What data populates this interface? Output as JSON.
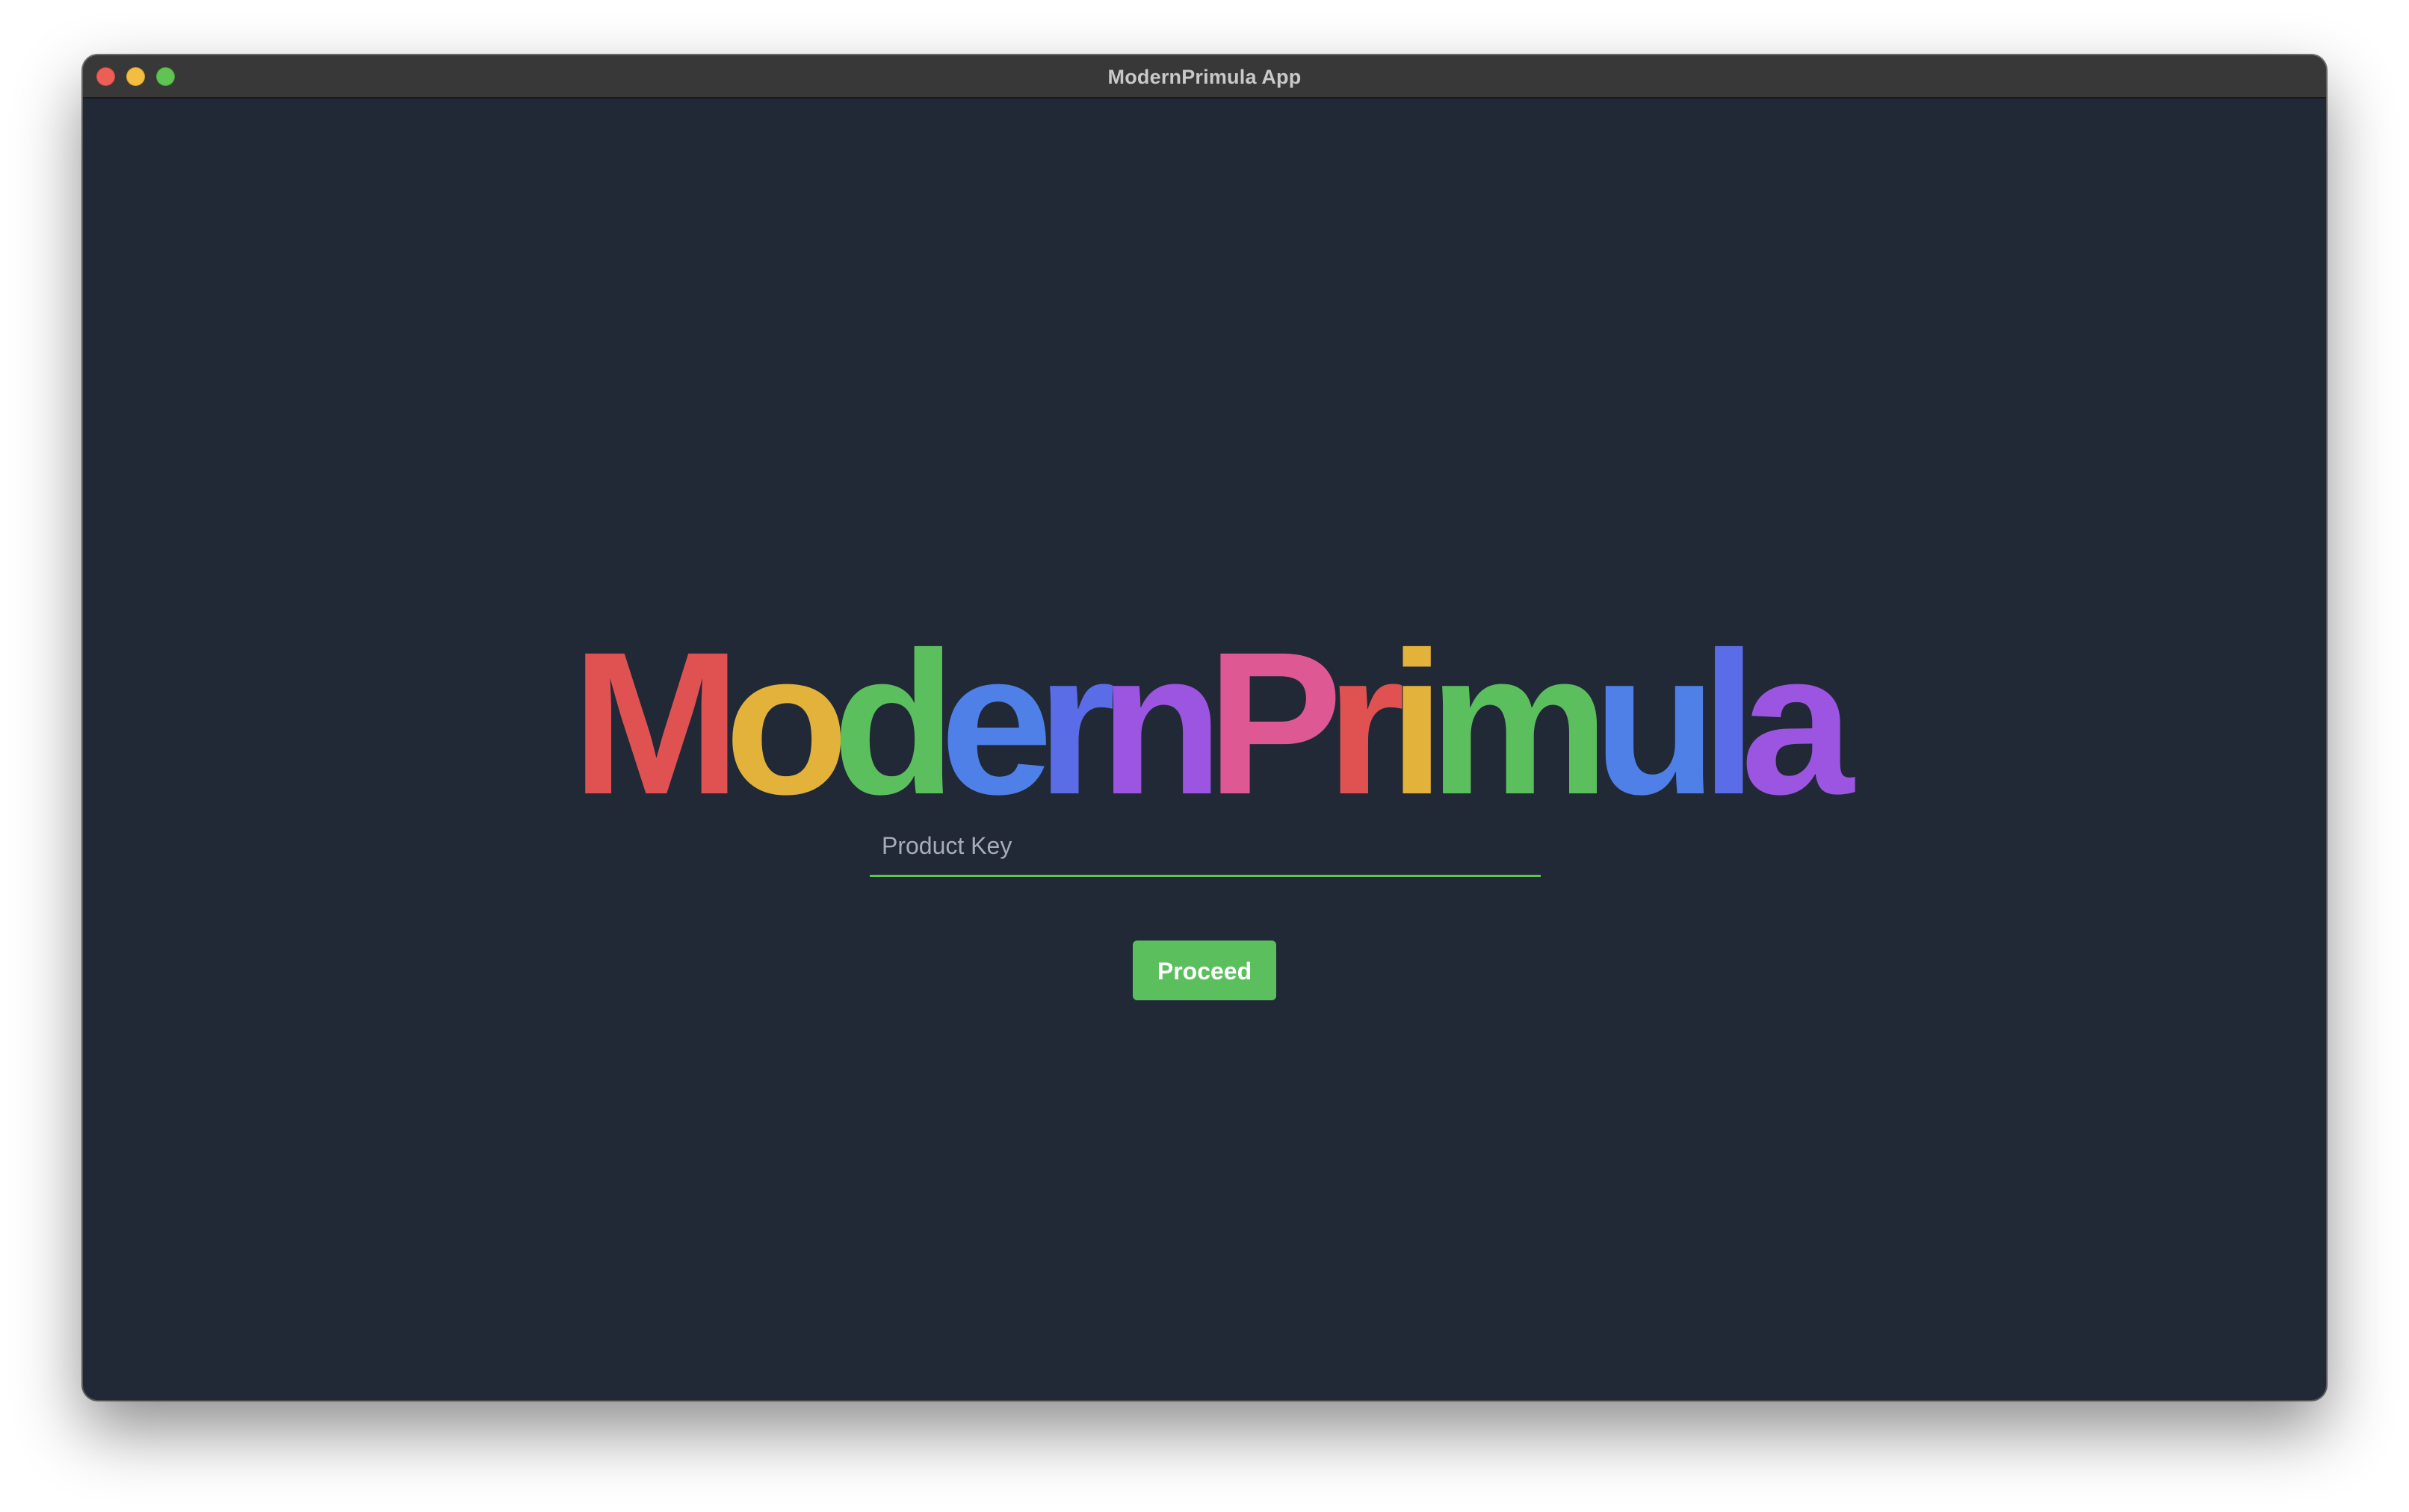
{
  "window": {
    "title": "ModernPrimula App"
  },
  "logo": {
    "text": "ModernPrimula",
    "letters": [
      {
        "char": "M",
        "color": "#e05252"
      },
      {
        "char": "o",
        "color": "#e2b23a"
      },
      {
        "char": "d",
        "color": "#5cbf5e"
      },
      {
        "char": "e",
        "color": "#4f80e8"
      },
      {
        "char": "r",
        "color": "#5a6de6"
      },
      {
        "char": "n",
        "color": "#9b55e0"
      },
      {
        "char": "P",
        "color": "#de5893"
      },
      {
        "char": "r",
        "color": "#e05252"
      },
      {
        "char": "i",
        "color": "#e2b23a"
      },
      {
        "char": "m",
        "color": "#5cbf5e"
      },
      {
        "char": "u",
        "color": "#4f80e8"
      },
      {
        "char": "l",
        "color": "#5a6de6"
      },
      {
        "char": "a",
        "color": "#9b55e0"
      }
    ]
  },
  "form": {
    "product_key_placeholder": "Product Key",
    "product_key_value": "",
    "proceed_label": "Proceed"
  },
  "colors": {
    "background": "#212836",
    "titlebar": "#383838",
    "accent": "#5cbf5e",
    "traffic_close": "#ec5f57",
    "traffic_minimize": "#f3bd40",
    "traffic_zoom": "#5fc454"
  },
  "icons": {
    "close": "close-window-icon",
    "minimize": "minimize-window-icon",
    "zoom": "zoom-window-icon"
  }
}
